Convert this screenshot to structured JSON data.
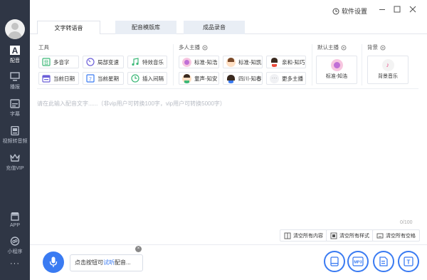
{
  "sidebar": {
    "items": [
      {
        "label": "配音",
        "icon": "text-a-icon"
      },
      {
        "label": "播报",
        "icon": "monitor-icon"
      },
      {
        "label": "字幕",
        "icon": "subtitle-icon"
      },
      {
        "label": "视频转音频",
        "icon": "video-icon"
      },
      {
        "label": "充值VIP",
        "icon": "crown-icon"
      },
      {
        "label": "APP",
        "icon": "store-icon"
      },
      {
        "label": "小程序",
        "icon": "miniprogram-icon"
      },
      {
        "label": "···",
        "icon": "more-icon"
      }
    ]
  },
  "titlebar": {
    "settings_label": "软件设置"
  },
  "tabs": [
    "文字转语音",
    "配音模版库",
    "成品录音"
  ],
  "tools": {
    "label": "工具",
    "buttons": [
      "多音字",
      "局部变速",
      "特效音乐",
      "当前日期",
      "当前星期",
      "插入间隔"
    ]
  },
  "voices": {
    "label": "多人主播",
    "buttons": [
      "标准-知浩",
      "标准-知凯",
      "亲和-知巧",
      "童声-知安",
      "四川-知春",
      "更多主播"
    ]
  },
  "default_anchor": {
    "label": "默认主播",
    "name": "标准-知浩"
  },
  "background": {
    "label": "背景",
    "name": "背景音乐"
  },
  "editor": {
    "placeholder": "请在此输入配音文字......（非vip用户可转换100字，vip用户可转换5000字）",
    "counter": "0/100"
  },
  "clear_buttons": [
    "清空所有内容",
    "清空所有样式",
    "清空所有空格"
  ],
  "bottom": {
    "hint_prefix": "点击按钮可",
    "hint_link": "试听",
    "hint_suffix": "配音...",
    "hint_close": "×",
    "mp3_label": "MP3",
    "t_label": "T"
  },
  "colors": {
    "accent": "#3a7bf2",
    "sidebar_bg": "#2f3645"
  }
}
